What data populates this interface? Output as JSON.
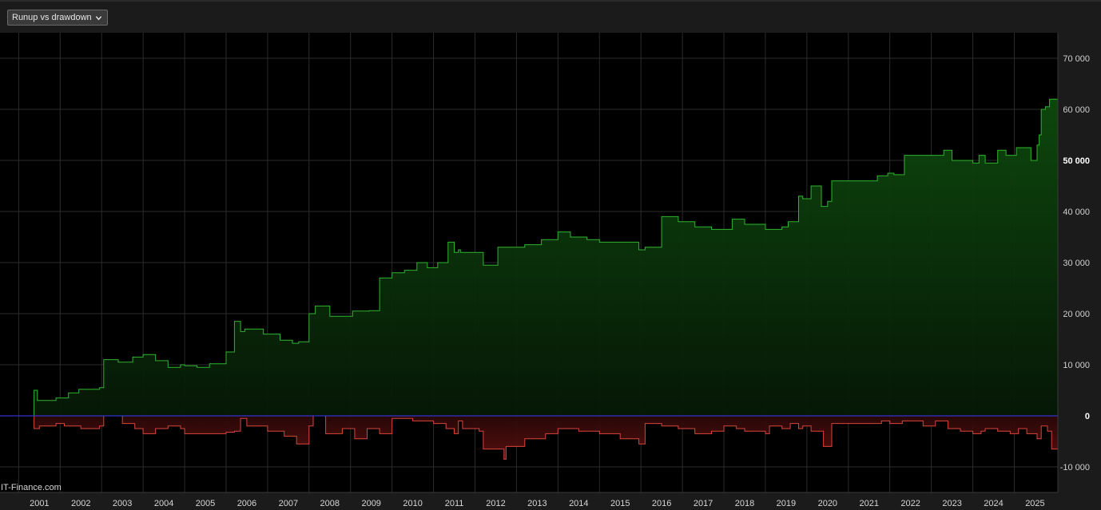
{
  "control": {
    "selected": "Runup vs drawdown",
    "icon": "chevron-down-icon"
  },
  "watermark": "IT-Finance.com",
  "colors": {
    "runup_line": "#2fb52f",
    "runup_fill": "#0b3a0b",
    "drawdown_line": "#d9443c",
    "drawdown_fill": "#4a0d0d",
    "zero_line": "#3b3bff",
    "background": "#000000"
  },
  "chart_data": {
    "type": "area",
    "grid": true,
    "legend": "none",
    "ylim": [
      -15000,
      75000
    ],
    "xlim": [
      2000.55,
      2026.05
    ],
    "y_ticks": [
      {
        "value": 70000,
        "label": "70 000",
        "bold": false
      },
      {
        "value": 60000,
        "label": "60 000",
        "bold": false
      },
      {
        "value": 50000,
        "label": "50 000",
        "bold": true
      },
      {
        "value": 40000,
        "label": "40 000",
        "bold": false
      },
      {
        "value": 30000,
        "label": "30 000",
        "bold": false
      },
      {
        "value": 20000,
        "label": "20 000",
        "bold": false
      },
      {
        "value": 10000,
        "label": "10 000",
        "bold": false
      },
      {
        "value": 0,
        "label": "0",
        "bold": true
      },
      {
        "value": -10000,
        "label": "-10 000",
        "bold": false
      }
    ],
    "x_ticks": [
      "2001",
      "2002",
      "2003",
      "2004",
      "2005",
      "2006",
      "2007",
      "2008",
      "2009",
      "2010",
      "2011",
      "2012",
      "2013",
      "2014",
      "2015",
      "2016",
      "2017",
      "2018",
      "2019",
      "2020",
      "2021",
      "2022",
      "2023",
      "2024",
      "2025"
    ],
    "series": [
      {
        "kind": "runup",
        "x": [
          2000.55,
          2001.35,
          2001.37,
          2001.45,
          2001.9,
          2002.2,
          2002.45,
          2002.95,
          2003.05,
          2003.4,
          2003.75,
          2004.0,
          2004.3,
          2004.6,
          2004.9,
          2005.0,
          2005.3,
          2005.6,
          2006.0,
          2006.2,
          2006.35,
          2006.45,
          2006.9,
          2007.3,
          2007.6,
          2007.75,
          2008.0,
          2008.15,
          2008.5,
          2008.9,
          2009.05,
          2009.45,
          2009.7,
          2010.0,
          2010.3,
          2010.6,
          2010.85,
          2011.1,
          2011.35,
          2011.5,
          2011.6,
          2011.65,
          2012.2,
          2012.55,
          2012.75,
          2013.2,
          2013.6,
          2014.0,
          2014.3,
          2014.7,
          2015.0,
          2015.4,
          2015.95,
          2016.1,
          2016.5,
          2016.9,
          2017.3,
          2017.7,
          2017.9,
          2018.2,
          2018.5,
          2019.0,
          2019.1,
          2019.4,
          2019.55,
          2019.8,
          2019.9,
          2020.1,
          2020.35,
          2020.5,
          2020.6,
          2020.85,
          2021.3,
          2021.7,
          2021.95,
          2022.1,
          2022.35,
          2022.8,
          2023.0,
          2023.3,
          2023.5,
          2023.9,
          2024.0,
          2024.15,
          2024.3,
          2024.6,
          2024.8,
          2025.05,
          2025.4,
          2025.55,
          2025.6,
          2025.65,
          2025.75,
          2025.85,
          2026.05
        ],
        "values": [
          0,
          0,
          5000,
          3000,
          3500,
          4500,
          5200,
          5500,
          11000,
          10500,
          11500,
          12000,
          10800,
          9500,
          10000,
          9800,
          9500,
          10200,
          12500,
          18500,
          16500,
          17000,
          16000,
          14800,
          14200,
          14500,
          20000,
          21500,
          19500,
          19500,
          20500,
          20600,
          27000,
          28000,
          28500,
          30000,
          29000,
          30000,
          34000,
          32000,
          32500,
          32000,
          29500,
          33000,
          33000,
          33500,
          34500,
          36000,
          35000,
          34500,
          34000,
          34000,
          32500,
          33000,
          39000,
          38000,
          37000,
          36500,
          36500,
          38500,
          37500,
          36500,
          36500,
          37000,
          38000,
          43000,
          42500,
          45000,
          41000,
          42000,
          46000,
          46000,
          46000,
          47000,
          47500,
          47200,
          51000,
          51000,
          51000,
          52000,
          50000,
          50000,
          49500,
          51000,
          49500,
          52000,
          51000,
          52500,
          50000,
          53000,
          55000,
          60000,
          60500,
          62000,
          61500
        ]
      },
      {
        "kind": "drawdown",
        "x": [
          2000.55,
          2001.3,
          2001.37,
          2001.5,
          2001.9,
          2002.1,
          2002.5,
          2002.95,
          2003.05,
          2003.5,
          2003.8,
          2004.0,
          2004.3,
          2004.6,
          2004.9,
          2005.0,
          2005.5,
          2006.0,
          2006.2,
          2006.35,
          2006.5,
          2007.0,
          2007.4,
          2007.7,
          2008.0,
          2008.1,
          2008.4,
          2008.8,
          2009.1,
          2009.4,
          2009.7,
          2010.0,
          2010.5,
          2011.0,
          2011.3,
          2011.5,
          2011.6,
          2011.7,
          2012.1,
          2012.2,
          2012.7,
          2012.75,
          2013.2,
          2013.7,
          2014.0,
          2014.5,
          2015.0,
          2015.5,
          2015.95,
          2016.1,
          2016.5,
          2016.9,
          2017.3,
          2017.7,
          2018.0,
          2018.3,
          2018.5,
          2019.0,
          2019.1,
          2019.4,
          2019.6,
          2019.8,
          2019.9,
          2020.1,
          2020.4,
          2020.6,
          2020.8,
          2021.2,
          2021.8,
          2022.0,
          2022.3,
          2022.8,
          2023.1,
          2023.4,
          2023.7,
          2024.0,
          2024.2,
          2024.3,
          2024.6,
          2024.9,
          2025.1,
          2025.3,
          2025.55,
          2025.65,
          2025.8,
          2025.9,
          2026.05
        ],
        "values": [
          0,
          0,
          -2500,
          -2000,
          -1500,
          -2000,
          -2500,
          -2000,
          0,
          -1500,
          -2500,
          -3500,
          -2500,
          -2000,
          -2500,
          -3500,
          -3500,
          -3200,
          -3000,
          -500,
          -2000,
          -3000,
          -4000,
          -5500,
          -2000,
          0,
          -3500,
          -2500,
          -4500,
          -2500,
          -3500,
          -500,
          -1000,
          -1500,
          -2500,
          -3500,
          -1000,
          -2500,
          -3000,
          -6500,
          -8500,
          -6000,
          -4500,
          -3500,
          -2500,
          -3000,
          -3500,
          -4500,
          -5500,
          -1500,
          -2000,
          -2500,
          -3500,
          -3000,
          -2000,
          -2500,
          -3000,
          -3500,
          -2000,
          -2500,
          -1500,
          -2500,
          -2000,
          -3000,
          -6000,
          -1500,
          -1500,
          -1500,
          -1000,
          -1500,
          -1000,
          -2000,
          -1000,
          -2500,
          -3000,
          -3500,
          -3000,
          -2500,
          -3000,
          -3500,
          -2500,
          -3500,
          -4500,
          -2000,
          -3000,
          -6500,
          -6000
        ]
      }
    ]
  }
}
